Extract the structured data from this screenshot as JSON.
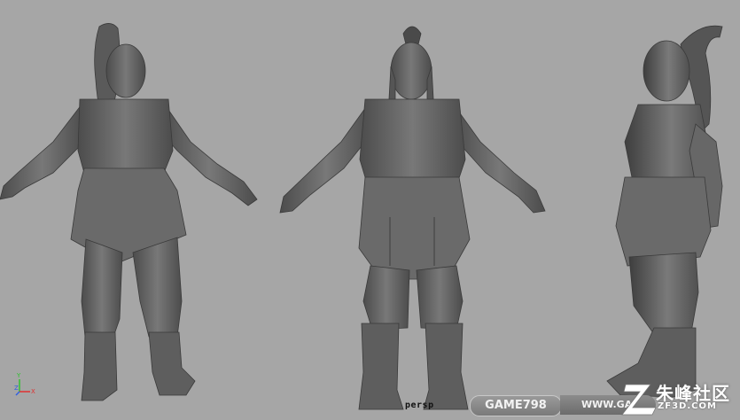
{
  "viewport": {
    "camera_label": "persp",
    "axis": {
      "y_label": "Y",
      "z_label": "Z",
      "x_label": "X"
    }
  },
  "watermarks": {
    "left_label": "GAME798",
    "right_label": "WWW.GA",
    "brand_name": "朱峰社区",
    "brand_url": "ZF3D.COM"
  },
  "colors": {
    "background": "#a6a6a6",
    "model": "#6e6e6e",
    "axis_x": "#e03030",
    "axis_y": "#30c030",
    "axis_z": "#3060e0"
  }
}
